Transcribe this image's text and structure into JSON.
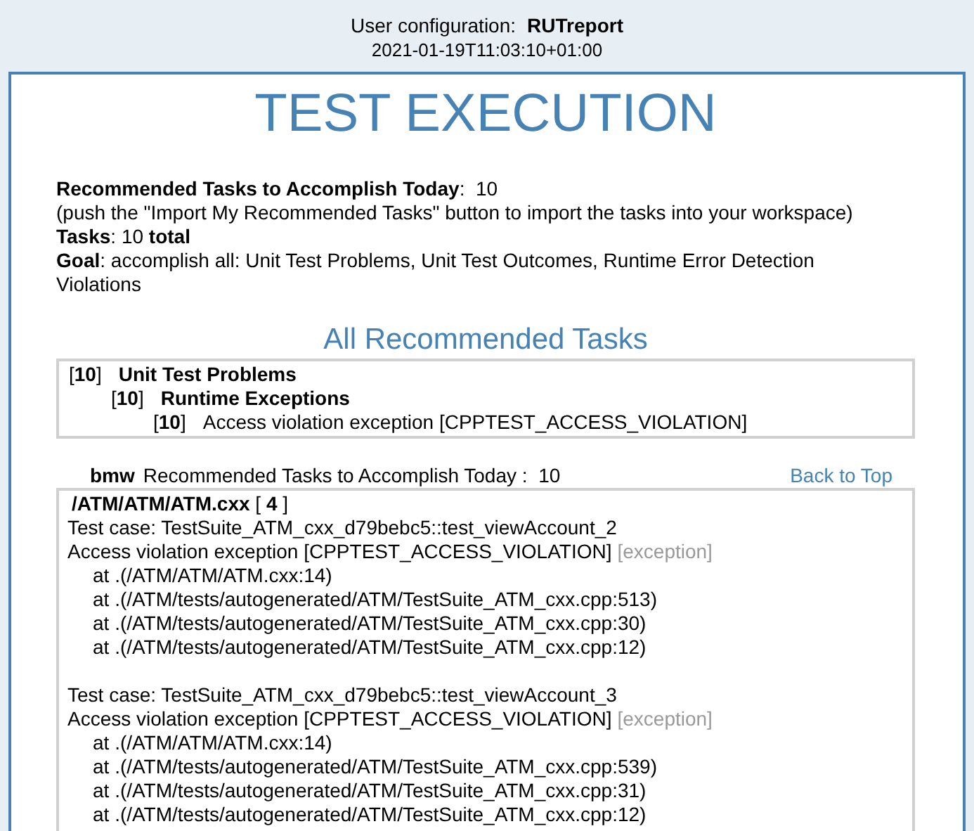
{
  "header": {
    "config_label": "User configuration:",
    "config_value": "RUTreport",
    "timestamp": "2021-01-19T11:03:10+01:00"
  },
  "title": "TEST EXECUTION",
  "summary": {
    "headline": "**Recommended Tasks to Accomplish Today**:  10",
    "note": "(push the \"Import My Recommended Tasks\" button to import the tasks into your workspace)",
    "tasks": "**Tasks**: 10 **total**",
    "goal": "**Goal**: accomplish all: Unit Test Problems, Unit Test Outcomes, Runtime Error Detection Violations"
  },
  "all_tasks": {
    "heading": "All Recommended Tasks",
    "tree": [
      {
        "count": "[**10**]",
        "label": "Unit Test Problems",
        "bold": true,
        "children": [
          {
            "count": "[**10**]",
            "label": "Runtime Exceptions",
            "bold": true,
            "children": [
              {
                "count": "[**10**]",
                "label": "Access violation exception [CPPTEST_ACCESS_VIOLATION]",
                "bold": false
              }
            ]
          }
        ]
      }
    ]
  },
  "user_section": {
    "user": "bmw",
    "label": "Recommended Tasks to Accomplish Today :",
    "value": "10",
    "link": "Back to Top",
    "file": "**/ATM/ATM/ATM.cxx** [ **4** ]",
    "cases": [
      {
        "test_case": "Test case: TestSuite_ATM_cxx_d79bebc5::test_viewAccount_2",
        "message": "Access violation exception [CPPTEST_ACCESS_VIOLATION]",
        "tag": "[exception]",
        "stack": [
          "at .(/ATM/ATM/ATM.cxx:14)",
          "at .(/ATM/tests/autogenerated/ATM/TestSuite_ATM_cxx.cpp:513)",
          "at .(/ATM/tests/autogenerated/ATM/TestSuite_ATM_cxx.cpp:30)",
          "at .(/ATM/tests/autogenerated/ATM/TestSuite_ATM_cxx.cpp:12)"
        ]
      },
      {
        "test_case": "Test case: TestSuite_ATM_cxx_d79bebc5::test_viewAccount_3",
        "message": "Access violation exception [CPPTEST_ACCESS_VIOLATION]",
        "tag": "[exception]",
        "stack": [
          "at .(/ATM/ATM/ATM.cxx:14)",
          "at .(/ATM/tests/autogenerated/ATM/TestSuite_ATM_cxx.cpp:539)",
          "at .(/ATM/tests/autogenerated/ATM/TestSuite_ATM_cxx.cpp:31)",
          "at .(/ATM/tests/autogenerated/ATM/TestSuite_ATM_cxx.cpp:12)"
        ]
      }
    ]
  }
}
